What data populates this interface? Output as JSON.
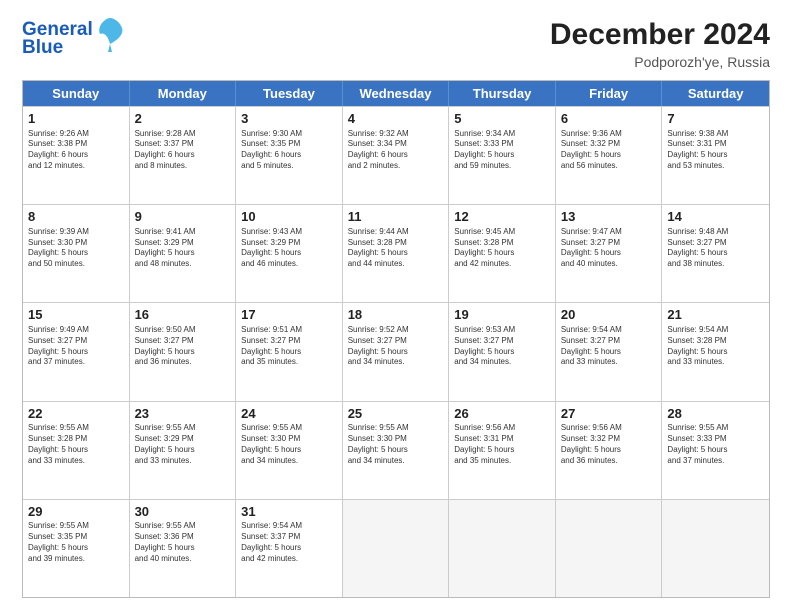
{
  "header": {
    "logo_line1": "General",
    "logo_line2": "Blue",
    "month": "December 2024",
    "location": "Podporozh'ye, Russia"
  },
  "days": [
    "Sunday",
    "Monday",
    "Tuesday",
    "Wednesday",
    "Thursday",
    "Friday",
    "Saturday"
  ],
  "rows": [
    [
      {
        "day": "1",
        "info": "Sunrise: 9:26 AM\nSunset: 3:38 PM\nDaylight: 6 hours\nand 12 minutes."
      },
      {
        "day": "2",
        "info": "Sunrise: 9:28 AM\nSunset: 3:37 PM\nDaylight: 6 hours\nand 8 minutes."
      },
      {
        "day": "3",
        "info": "Sunrise: 9:30 AM\nSunset: 3:35 PM\nDaylight: 6 hours\nand 5 minutes."
      },
      {
        "day": "4",
        "info": "Sunrise: 9:32 AM\nSunset: 3:34 PM\nDaylight: 6 hours\nand 2 minutes."
      },
      {
        "day": "5",
        "info": "Sunrise: 9:34 AM\nSunset: 3:33 PM\nDaylight: 5 hours\nand 59 minutes."
      },
      {
        "day": "6",
        "info": "Sunrise: 9:36 AM\nSunset: 3:32 PM\nDaylight: 5 hours\nand 56 minutes."
      },
      {
        "day": "7",
        "info": "Sunrise: 9:38 AM\nSunset: 3:31 PM\nDaylight: 5 hours\nand 53 minutes."
      }
    ],
    [
      {
        "day": "8",
        "info": "Sunrise: 9:39 AM\nSunset: 3:30 PM\nDaylight: 5 hours\nand 50 minutes."
      },
      {
        "day": "9",
        "info": "Sunrise: 9:41 AM\nSunset: 3:29 PM\nDaylight: 5 hours\nand 48 minutes."
      },
      {
        "day": "10",
        "info": "Sunrise: 9:43 AM\nSunset: 3:29 PM\nDaylight: 5 hours\nand 46 minutes."
      },
      {
        "day": "11",
        "info": "Sunrise: 9:44 AM\nSunset: 3:28 PM\nDaylight: 5 hours\nand 44 minutes."
      },
      {
        "day": "12",
        "info": "Sunrise: 9:45 AM\nSunset: 3:28 PM\nDaylight: 5 hours\nand 42 minutes."
      },
      {
        "day": "13",
        "info": "Sunrise: 9:47 AM\nSunset: 3:27 PM\nDaylight: 5 hours\nand 40 minutes."
      },
      {
        "day": "14",
        "info": "Sunrise: 9:48 AM\nSunset: 3:27 PM\nDaylight: 5 hours\nand 38 minutes."
      }
    ],
    [
      {
        "day": "15",
        "info": "Sunrise: 9:49 AM\nSunset: 3:27 PM\nDaylight: 5 hours\nand 37 minutes."
      },
      {
        "day": "16",
        "info": "Sunrise: 9:50 AM\nSunset: 3:27 PM\nDaylight: 5 hours\nand 36 minutes."
      },
      {
        "day": "17",
        "info": "Sunrise: 9:51 AM\nSunset: 3:27 PM\nDaylight: 5 hours\nand 35 minutes."
      },
      {
        "day": "18",
        "info": "Sunrise: 9:52 AM\nSunset: 3:27 PM\nDaylight: 5 hours\nand 34 minutes."
      },
      {
        "day": "19",
        "info": "Sunrise: 9:53 AM\nSunset: 3:27 PM\nDaylight: 5 hours\nand 34 minutes."
      },
      {
        "day": "20",
        "info": "Sunrise: 9:54 AM\nSunset: 3:27 PM\nDaylight: 5 hours\nand 33 minutes."
      },
      {
        "day": "21",
        "info": "Sunrise: 9:54 AM\nSunset: 3:28 PM\nDaylight: 5 hours\nand 33 minutes."
      }
    ],
    [
      {
        "day": "22",
        "info": "Sunrise: 9:55 AM\nSunset: 3:28 PM\nDaylight: 5 hours\nand 33 minutes."
      },
      {
        "day": "23",
        "info": "Sunrise: 9:55 AM\nSunset: 3:29 PM\nDaylight: 5 hours\nand 33 minutes."
      },
      {
        "day": "24",
        "info": "Sunrise: 9:55 AM\nSunset: 3:30 PM\nDaylight: 5 hours\nand 34 minutes."
      },
      {
        "day": "25",
        "info": "Sunrise: 9:55 AM\nSunset: 3:30 PM\nDaylight: 5 hours\nand 34 minutes."
      },
      {
        "day": "26",
        "info": "Sunrise: 9:56 AM\nSunset: 3:31 PM\nDaylight: 5 hours\nand 35 minutes."
      },
      {
        "day": "27",
        "info": "Sunrise: 9:56 AM\nSunset: 3:32 PM\nDaylight: 5 hours\nand 36 minutes."
      },
      {
        "day": "28",
        "info": "Sunrise: 9:55 AM\nSunset: 3:33 PM\nDaylight: 5 hours\nand 37 minutes."
      }
    ],
    [
      {
        "day": "29",
        "info": "Sunrise: 9:55 AM\nSunset: 3:35 PM\nDaylight: 5 hours\nand 39 minutes."
      },
      {
        "day": "30",
        "info": "Sunrise: 9:55 AM\nSunset: 3:36 PM\nDaylight: 5 hours\nand 40 minutes."
      },
      {
        "day": "31",
        "info": "Sunrise: 9:54 AM\nSunset: 3:37 PM\nDaylight: 5 hours\nand 42 minutes."
      },
      {
        "day": "",
        "info": ""
      },
      {
        "day": "",
        "info": ""
      },
      {
        "day": "",
        "info": ""
      },
      {
        "day": "",
        "info": ""
      }
    ]
  ]
}
